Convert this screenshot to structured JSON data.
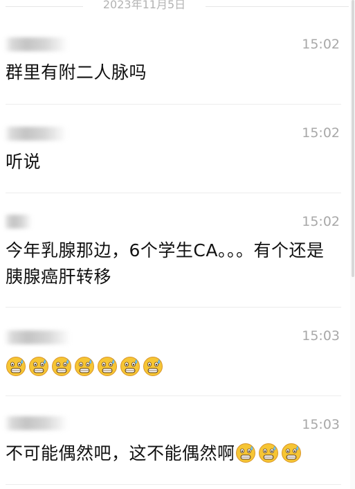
{
  "date_divider": "2023年11月5日",
  "messages": [
    {
      "time": "15:02",
      "text": "群里有附二人脉吗",
      "emoji_count": 0
    },
    {
      "time": "15:02",
      "text": "听说",
      "emoji_count": 0
    },
    {
      "time": "15:02",
      "text": "今年乳腺那边，6个学生CA。。。有个还是胰腺癌肝转移",
      "emoji_count": 0
    },
    {
      "time": "15:03",
      "text": "",
      "emoji_count": 7
    },
    {
      "time": "15:03",
      "text": "不可能偶然吧，这不能偶然啊",
      "emoji_count": 3
    }
  ],
  "emoji_name": "sweating-grin-emoji-icon",
  "colors": {
    "emoji_face": "#f6c534",
    "emoji_outline": "#d9962a",
    "time_text": "#a8a8a8",
    "body_text": "#111111",
    "separator": "#ececec"
  }
}
